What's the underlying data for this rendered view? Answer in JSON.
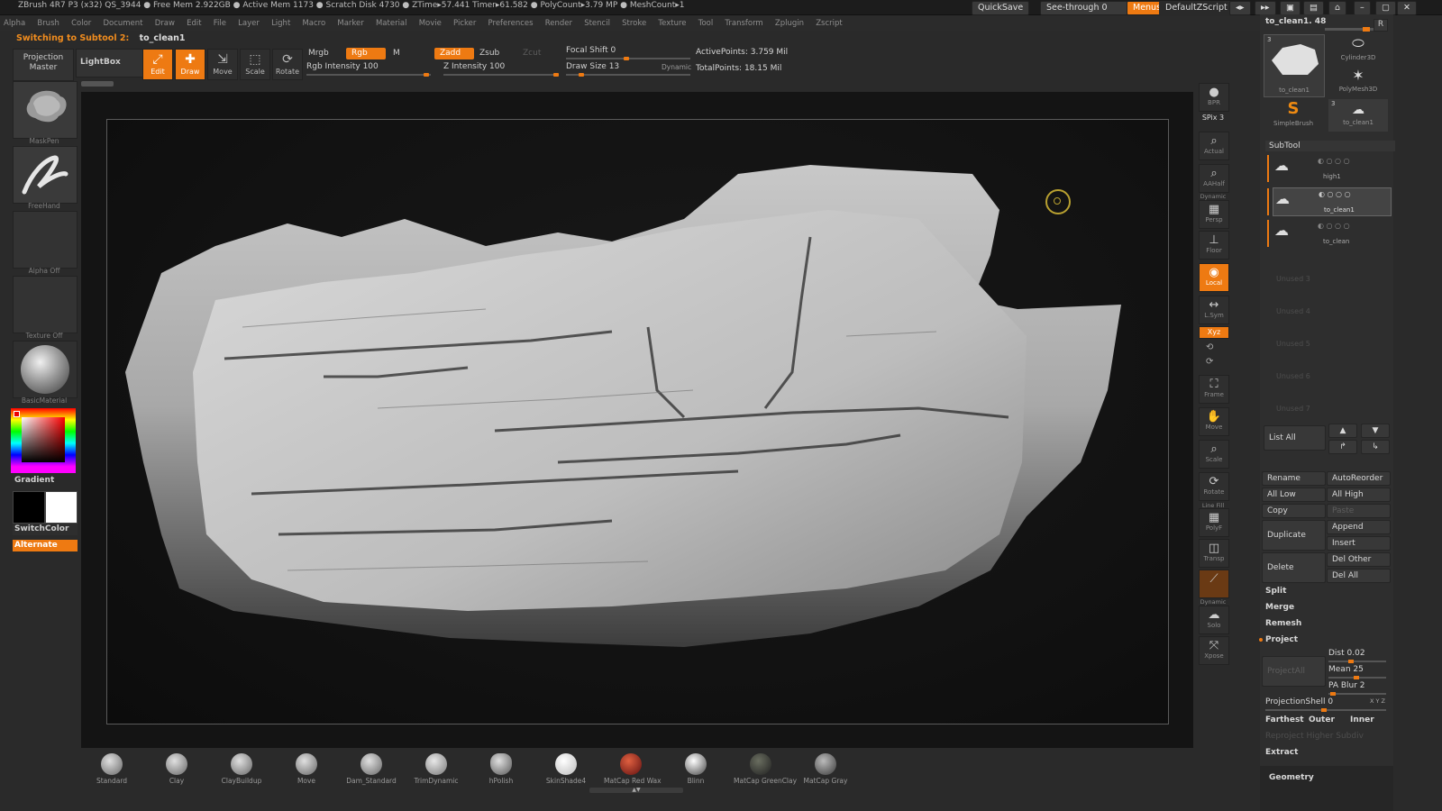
{
  "titlebar": {
    "title": "ZBrush 4R7 P3 (x32)  QS_3944  ● Free Mem 2.922GB ● Active Mem 1173 ● Scratch Disk 4730 ● ZTime▸57.441 Timer▸61.582 ● PolyCount▸3.79 MP ● MeshCount▸1",
    "quicksave": "QuickSave",
    "seethrough": "See-through  0",
    "menus": "Menus",
    "script": "DefaultZScript"
  },
  "menus": [
    "Alpha",
    "Brush",
    "Color",
    "Document",
    "Draw",
    "Edit",
    "File",
    "Layer",
    "Light",
    "Macro",
    "Marker",
    "Material",
    "Movie",
    "Picker",
    "Preferences",
    "Render",
    "Stencil",
    "Stroke",
    "Texture",
    "Tool",
    "Transform",
    "Zplugin",
    "Zscript"
  ],
  "notice": {
    "label": "Switching to Subtool 2:",
    "name": "to_clean1"
  },
  "toolbar": {
    "projection_master": "Projection Master",
    "lightbox": "LightBox",
    "edit": "Edit",
    "draw": "Draw",
    "move": "Move",
    "scale": "Scale",
    "rotate": "Rotate",
    "mrgb": "Mrgb",
    "rgb": "Rgb",
    "m": "M",
    "zadd": "Zadd",
    "zsub": "Zsub",
    "zcut": "Zcut",
    "rgb_intensity": "Rgb  Intensity 100",
    "z_intensity": "Z  Intensity 100",
    "focal_shift": "Focal  Shift 0",
    "draw_size": "Draw  Size 13",
    "dynamic": "Dynamic",
    "active_points": "ActivePoints: 3.759  Mil",
    "total_points": "TotalPoints: 18.15  Mil"
  },
  "left_shelf": {
    "brush": "MaskPen",
    "stroke": "FreeHand",
    "alpha": "Alpha  Off",
    "texture": "Texture  Off",
    "material": "BasicMaterial",
    "gradient": "Gradient",
    "switchcolor": "SwitchColor",
    "alternate": "Alternate"
  },
  "right_shelf": [
    "BPR",
    "SPix 3",
    "Actual",
    "AAHalf",
    "Persp",
    "Floor",
    "Local",
    "L.Sym",
    "Xyz",
    "Frame",
    "Move",
    "Scale",
    "Rotate",
    "PolyF",
    "Transp",
    "Solo",
    "Xpose"
  ],
  "right_shelf_labels": {
    "dynamic": "Dynamic",
    "line_fill": "Line Fill",
    "dynamic2": "Dynamic"
  },
  "tool_panel": {
    "current_tool": "to_clean1. 48",
    "r": "R",
    "tools": [
      {
        "name": "to_clean1",
        "count": "3"
      },
      {
        "name": "Cylinder3D"
      },
      {
        "name": "PolyMesh3D"
      },
      {
        "name": "SimpleBrush"
      },
      {
        "name": "to_clean1",
        "count": "3"
      }
    ]
  },
  "subtool": {
    "header": "SubTool",
    "items": [
      "high1",
      "to_clean1",
      "to_clean"
    ],
    "unused": [
      "Unused 3",
      "Unused 4",
      "Unused 5",
      "Unused 6",
      "Unused 7"
    ],
    "list_all": "List All",
    "buttons": {
      "rename": "Rename",
      "autoreorder": "AutoReorder",
      "all_low": "All Low",
      "all_high": "All High",
      "copy": "Copy",
      "paste": "Paste",
      "duplicate": "Duplicate",
      "append": "Append",
      "insert": "Insert",
      "delete": "Delete",
      "del_other": "Del Other",
      "del_all": "Del All",
      "split": "Split",
      "merge": "Merge",
      "remesh": "Remesh",
      "project": "Project",
      "projectall": "ProjectAll",
      "dist": "Dist 0.02",
      "mean": "Mean 25",
      "pa_blur": "PA Blur 2",
      "projectionshell": "ProjectionShell 0",
      "xyz": "X Y Z",
      "farthest": "Farthest",
      "outer": "Outer",
      "inner": "Inner",
      "reproject": "Reproject  Higher  Subdiv",
      "extract": "Extract",
      "geometry": "Geometry"
    }
  },
  "materials": [
    "Standard",
    "Clay",
    "ClayBuildup",
    "Move",
    "Dam_Standard",
    "TrimDynamic",
    "hPolish",
    "SkinShade4",
    "MatCap  Red  Wax",
    "Blinn",
    "MatCap  GreenClay",
    "MatCap  Gray"
  ],
  "colors": {
    "accent": "#ee7a12",
    "bg": "#2a2a2a",
    "viewport": "#141414"
  }
}
